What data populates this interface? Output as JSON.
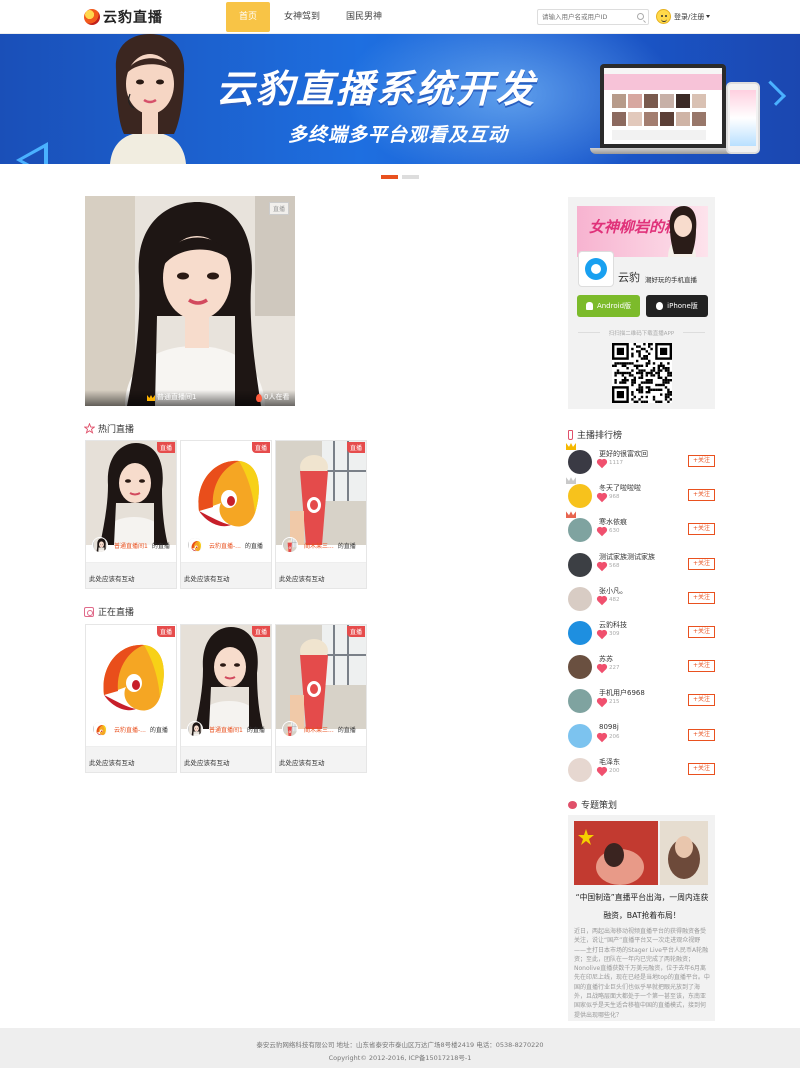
{
  "header": {
    "logo_text": "云豹直播",
    "nav": [
      {
        "label": "首页",
        "active": true
      },
      {
        "label": "女神驾到",
        "active": false
      },
      {
        "label": "国民男神",
        "active": false
      }
    ],
    "search_placeholder": "请输入用户名或用户ID",
    "login_label": "登录/注册"
  },
  "banner": {
    "title": "云豹直播系统开发",
    "subtitle": "多终端多平台观看及互动",
    "slides": 2,
    "active_slide": 1
  },
  "featured": {
    "badge": "直播",
    "name": "普通直播间1",
    "viewers": "0人在看"
  },
  "hot_section": {
    "title": "热门直播",
    "cards": [
      {
        "badge": "直播",
        "user": "普通直播间1",
        "suffix": "的直播",
        "desc": "此处应该有互动",
        "thumb": "girl"
      },
      {
        "badge": "直播",
        "user": "云豹直播-...",
        "suffix": "的直播",
        "desc": "此处应该有互动",
        "thumb": "logo"
      },
      {
        "badge": "直播",
        "user": "阁木某三...",
        "suffix": "的直播",
        "desc": "此处应该有互动",
        "thumb": "icecream"
      }
    ]
  },
  "live_section": {
    "title": "正在直播",
    "cards": [
      {
        "badge": "直播",
        "user": "云豹直播-...",
        "suffix": "的直播",
        "desc": "此处应该有互动",
        "thumb": "logo"
      },
      {
        "badge": "直播",
        "user": "普通直播间1",
        "suffix": "的直播",
        "desc": "此处应该有互动",
        "thumb": "girl"
      },
      {
        "badge": "直播",
        "user": "阁木某三...",
        "suffix": "的直播",
        "desc": "此处应该有互动",
        "thumb": "icecream"
      }
    ]
  },
  "app_box": {
    "ad_text": "女神柳岩的秘密",
    "app_name": "云豹",
    "slogan": "潮好玩的手机直播",
    "android_label": "Android版",
    "iphone_label": "iPhone版",
    "scan_text": "扫扫描二维码下载直播APP"
  },
  "ranking": {
    "title": "主播排行榜",
    "follow_label": "+关注",
    "items": [
      {
        "name": "更好的很富欢回",
        "count": "1117",
        "crown": "#f5b800",
        "color": "#3a3a44"
      },
      {
        "name": "冬天了啦啦啦",
        "count": "968",
        "crown": "#c9c9c9",
        "color": "#f7c21c"
      },
      {
        "name": "寒水依痕",
        "count": "630",
        "crown": "#e8654f",
        "color": "#7fa3a0"
      },
      {
        "name": "测试家族测试家族",
        "count": "568",
        "crown": "",
        "color": "#3c3f44"
      },
      {
        "name": "张小凡。",
        "count": "482",
        "crown": "",
        "color": "#d8ccc4"
      },
      {
        "name": "云豹科技",
        "count": "309",
        "crown": "",
        "color": "#1e8fe0"
      },
      {
        "name": "苏苏",
        "count": "227",
        "crown": "",
        "color": "#6a5040"
      },
      {
        "name": "手机用户6968",
        "count": "215",
        "crown": "",
        "color": "#7fa3a0"
      },
      {
        "name": "8098j",
        "count": "206",
        "crown": "",
        "color": "#7cc3ef"
      },
      {
        "name": "毛泽东",
        "count": "200",
        "crown": "",
        "color": "#e6d7d0"
      }
    ]
  },
  "topic": {
    "title": "专题策划",
    "headline": "“中国制造”直播平台出海，一周内连获融资，BAT抢着布局！",
    "body": "近日，两起出海移动视频直播平台的获得融资备受关注，说让“国产”直播平台又一次走进观众视野——主打日本市场的Stager Live平台人民币A轮融资；至此，团队在一年内已完成了两轮融资；Nonolive直播获数千万美元融资，位于去年6月离先在印尼上线，现在已经是当地top的直播平台。中国的直播行业巨头们也似乎早就把眼光放到了海外，且战略层面大都处于一个第一甚至该，东南亚国家似乎是天生适合移植中国的直播模式，接到何提供出现哪些化？"
  },
  "footer": {
    "line1": "泰安云豹网络科技有限公司 地址：山东省泰安市泰山区万达广场8号楼2419 电话：0538-8270220",
    "line2": "Copyright© 2012-2016, ICP备15017218号-1"
  },
  "colors": {
    "accent": "#e9511f",
    "nav_active": "#f8c446",
    "live_badge": "#e64c4c",
    "banner_blue": "#1e6fe0"
  }
}
